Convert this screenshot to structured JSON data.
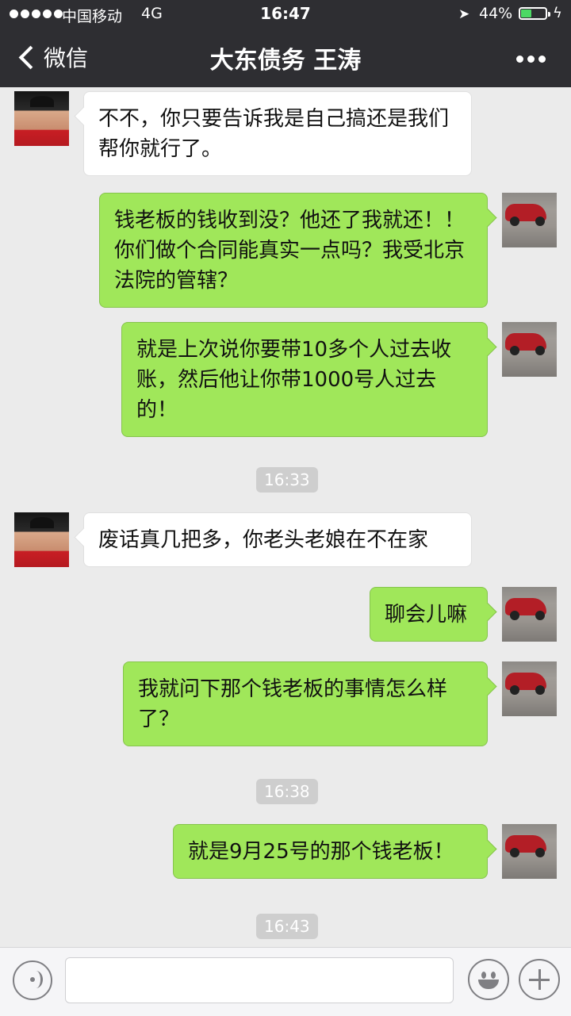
{
  "status_bar": {
    "carrier": "中国移动",
    "network": "4G",
    "time": "16:47",
    "battery_percent": "44%",
    "battery_level": 0.44,
    "icons": [
      "signal-dots-icon",
      "location-arrow-icon",
      "battery-icon",
      "charging-bolt-icon"
    ]
  },
  "nav": {
    "back_label": "微信",
    "title": "大东债务  王涛",
    "more_icon": "more-dots-icon"
  },
  "messages": [
    {
      "side": "in",
      "text": "不不，你只要告诉我是自己搞还是我们帮你就行了。"
    },
    {
      "side": "out",
      "text": "钱老板的钱收到没？他还了我就还！！你们做个合同能真实一点吗？我受北京法院的管辖？"
    },
    {
      "side": "out",
      "text": "就是上次说你要带10多个人过去收账，然后他让你带1000号人过去的！"
    },
    {
      "time": "16:33"
    },
    {
      "side": "in",
      "text": "废话真几把多，你老头老娘在不在家"
    },
    {
      "side": "out",
      "text": "聊会儿嘛"
    },
    {
      "side": "out",
      "text": "我就问下那个钱老板的事情怎么样了？"
    },
    {
      "time": "16:38"
    },
    {
      "side": "out",
      "text": "就是9月25号的那个钱老板！"
    },
    {
      "time": "16:43"
    }
  ],
  "input_bar": {
    "icons": [
      "voice-icon",
      "emoji-icon",
      "plus-icon"
    ],
    "value": ""
  }
}
